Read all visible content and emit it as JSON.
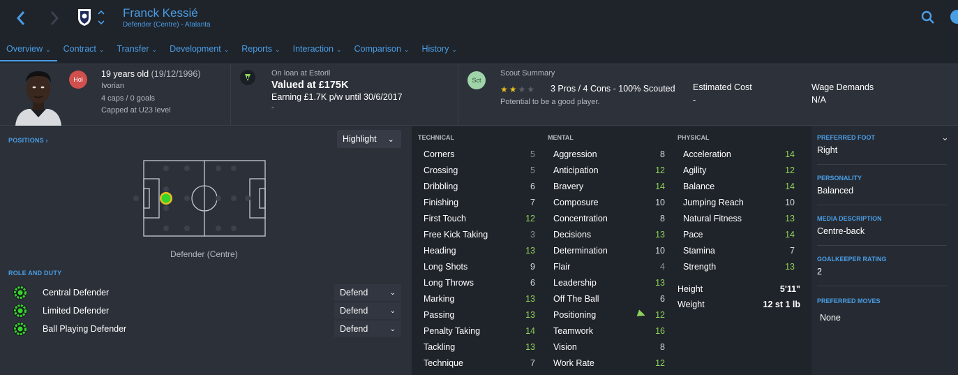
{
  "header": {
    "player_name": "Franck Kessié",
    "subtitle": "Defender (Centre) - Atalanta"
  },
  "tabs": [
    {
      "label": "Overview"
    },
    {
      "label": "Contract"
    },
    {
      "label": "Transfer"
    },
    {
      "label": "Development"
    },
    {
      "label": "Reports"
    },
    {
      "label": "Interaction"
    },
    {
      "label": "Comparison"
    },
    {
      "label": "History"
    }
  ],
  "info": {
    "nationality_badge": "Hol",
    "age_text": "19 years old",
    "dob": "(19/12/1996)",
    "nationality": "Ivorian",
    "caps": "4 caps / 0 goals",
    "capped": "Capped at U23 level",
    "loan_line": "On loan at Estoril",
    "valued": "Valued at £175K",
    "earning": "Earning £1.7K p/w until 30/6/2017",
    "dash": "-",
    "scout_badge": "Sct",
    "scout_title": "Scout Summary",
    "scout_stars": 2,
    "scout_stars_max": 4,
    "scout_text": "3 Pros / 4 Cons - 100% Scouted",
    "scout_potential": "Potential to be a good player.",
    "estimated_cost_label": "Estimated Cost",
    "estimated_cost_value": "-",
    "wage_label": "Wage Demands",
    "wage_value": "N/A"
  },
  "left": {
    "positions_title": "POSITIONS",
    "highlight_label": "Highlight",
    "position_label": "Defender (Centre)",
    "role_title": "ROLE AND DUTY",
    "roles": [
      {
        "name": "Central Defender",
        "duty": "Defend"
      },
      {
        "name": "Limited Defender",
        "duty": "Defend"
      },
      {
        "name": "Ball Playing Defender",
        "duty": "Defend"
      }
    ]
  },
  "attributes": {
    "technical_title": "TECHNICAL",
    "mental_title": "MENTAL",
    "physical_title": "PHYSICAL",
    "technical": [
      {
        "name": "Corners",
        "value": "5"
      },
      {
        "name": "Crossing",
        "value": "5"
      },
      {
        "name": "Dribbling",
        "value": "6"
      },
      {
        "name": "Finishing",
        "value": "7"
      },
      {
        "name": "First Touch",
        "value": "12"
      },
      {
        "name": "Free Kick Taking",
        "value": "3"
      },
      {
        "name": "Heading",
        "value": "13"
      },
      {
        "name": "Long Shots",
        "value": "9"
      },
      {
        "name": "Long Throws",
        "value": "6"
      },
      {
        "name": "Marking",
        "value": "13"
      },
      {
        "name": "Passing",
        "value": "13"
      },
      {
        "name": "Penalty Taking",
        "value": "14"
      },
      {
        "name": "Tackling",
        "value": "13"
      },
      {
        "name": "Technique",
        "value": "7"
      }
    ],
    "mental": [
      {
        "name": "Aggression",
        "value": "8"
      },
      {
        "name": "Anticipation",
        "value": "12"
      },
      {
        "name": "Bravery",
        "value": "14"
      },
      {
        "name": "Composure",
        "value": "10"
      },
      {
        "name": "Concentration",
        "value": "8"
      },
      {
        "name": "Decisions",
        "value": "13"
      },
      {
        "name": "Determination",
        "value": "10"
      },
      {
        "name": "Flair",
        "value": "4"
      },
      {
        "name": "Leadership",
        "value": "13"
      },
      {
        "name": "Off The Ball",
        "value": "6"
      },
      {
        "name": "Positioning",
        "value": "12"
      },
      {
        "name": "Teamwork",
        "value": "16"
      },
      {
        "name": "Vision",
        "value": "8"
      },
      {
        "name": "Work Rate",
        "value": "12"
      }
    ],
    "physical": [
      {
        "name": "Acceleration",
        "value": "14"
      },
      {
        "name": "Agility",
        "value": "12"
      },
      {
        "name": "Balance",
        "value": "14"
      },
      {
        "name": "Jumping Reach",
        "value": "10"
      },
      {
        "name": "Natural Fitness",
        "value": "13"
      },
      {
        "name": "Pace",
        "value": "14"
      },
      {
        "name": "Stamina",
        "value": "7"
      },
      {
        "name": "Strength",
        "value": "13"
      }
    ],
    "height_label": "Height",
    "height_value": "5'11\"",
    "weight_label": "Weight",
    "weight_value": "12 st 1 lb"
  },
  "right": {
    "preferred_foot_title": "PREFERRED FOOT",
    "preferred_foot": "Right",
    "personality_title": "PERSONALITY",
    "personality": "Balanced",
    "media_title": "MEDIA DESCRIPTION",
    "media": "Centre-back",
    "gk_title": "GOALKEEPER RATING",
    "gk": "2",
    "moves_title": "PREFERRED MOVES",
    "moves": "None"
  },
  "colors": {
    "accent": "#4a9ee6",
    "high": "#8fd25a",
    "star": "#e8c01f"
  }
}
